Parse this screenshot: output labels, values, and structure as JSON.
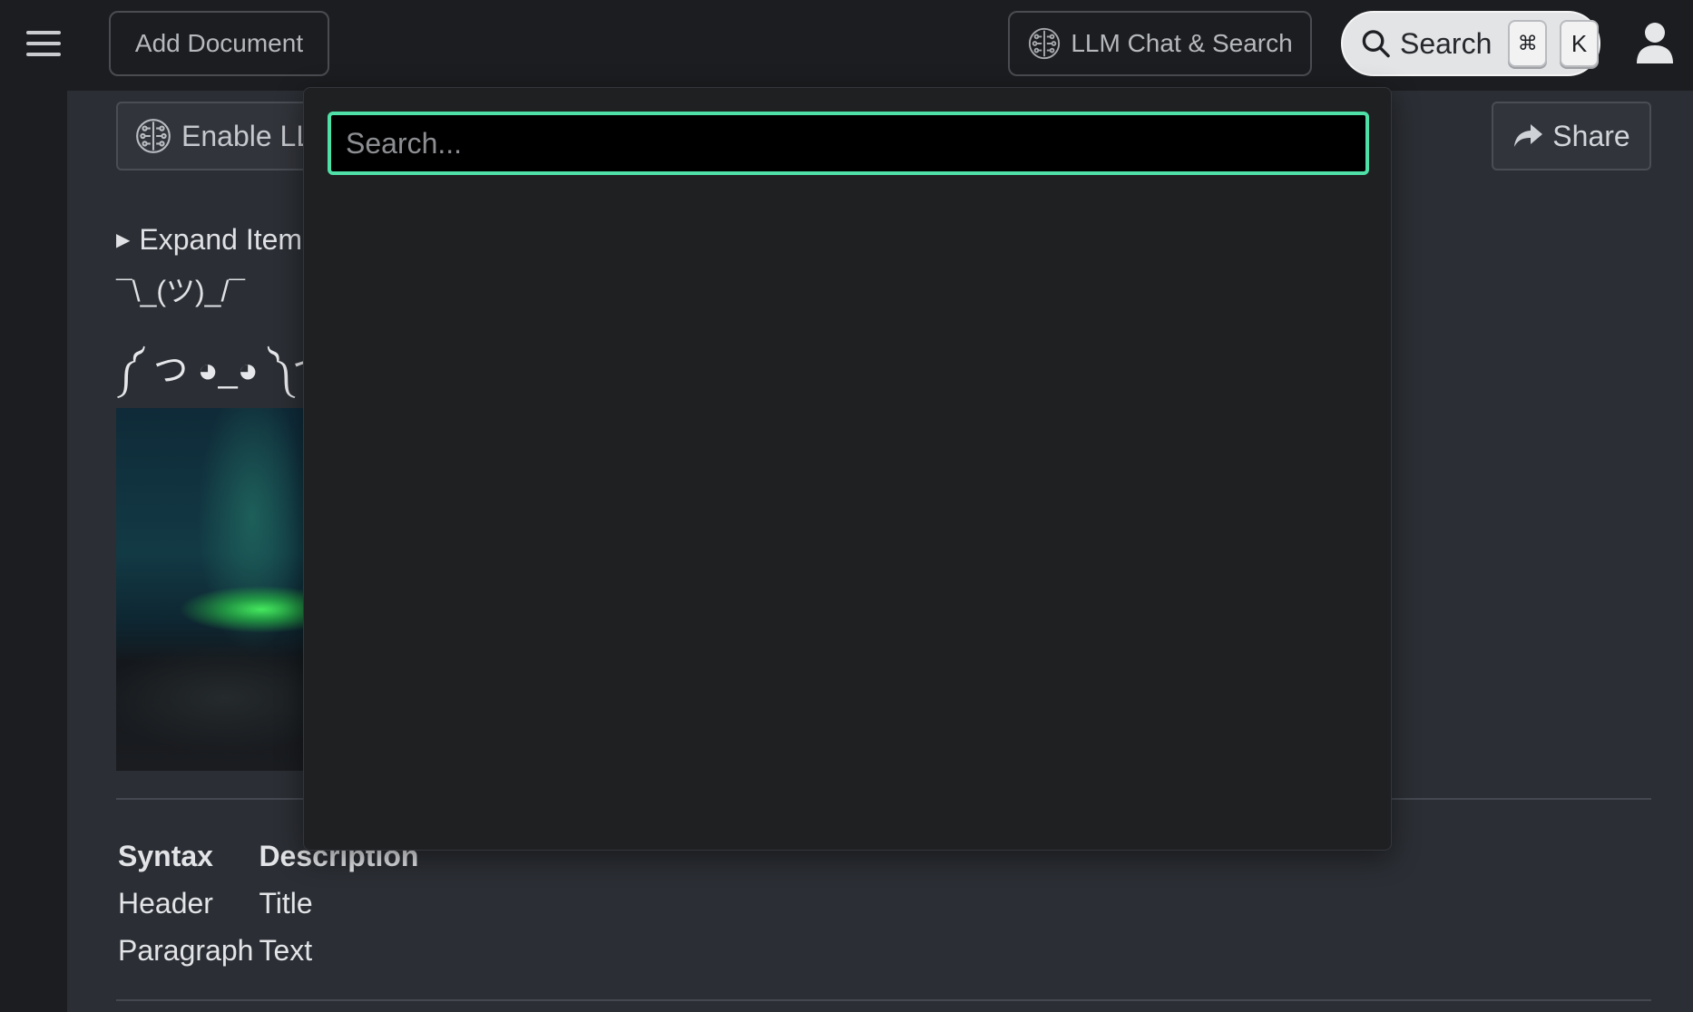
{
  "topbar": {
    "add_document_label": "Add Document",
    "llm_chat_label": "LLM Chat & Search",
    "search_label": "Search",
    "search_shortcut_mod": "⌘",
    "search_shortcut_key": "K"
  },
  "document": {
    "enable_llm_label": "Enable LLM",
    "share_label": "Share",
    "expand_items_label": "Expand Items",
    "shrug_text": "¯\\_(ツ)_/¯",
    "lenny_text": "༼ つ ◕_◕ ༽つ",
    "table": {
      "headers": [
        "Syntax",
        "Description"
      ],
      "rows": [
        [
          "Header",
          "Title"
        ],
        [
          "Paragraph",
          "Text"
        ]
      ]
    }
  },
  "search_modal": {
    "placeholder": "Search...",
    "value": ""
  },
  "colors": {
    "focus_ring": "#4fe0a8",
    "topbar_bg": "#1c1d20",
    "document_bg": "#2b2e34",
    "modal_bg": "#1f2022"
  }
}
